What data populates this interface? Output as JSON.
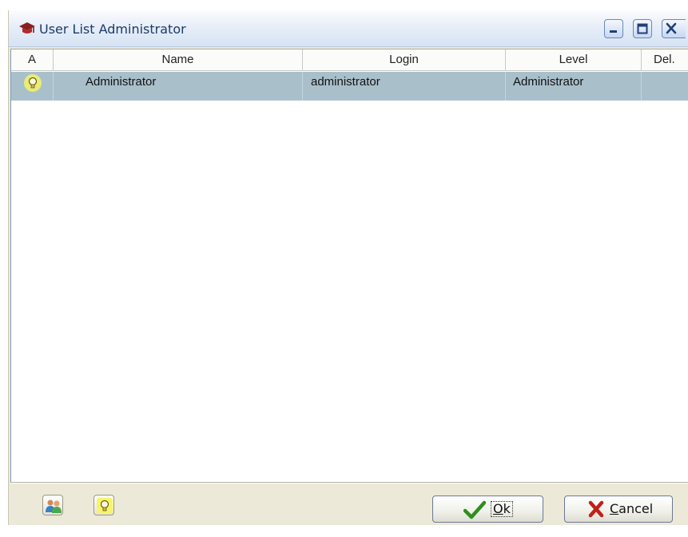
{
  "window": {
    "title": "User List Administrator",
    "app_icon": "mortarboard-icon",
    "controls": [
      "minimize-icon",
      "maximize-icon",
      "close-icon"
    ]
  },
  "grid": {
    "columns": [
      "A",
      "Name",
      "Login",
      "Level",
      "Del."
    ],
    "rows": [
      {
        "active_icon": "lightbulb-icon",
        "name": "Administrator",
        "login": "administrator",
        "level": "Administrator",
        "del": ""
      }
    ],
    "selected_row_color": "#a9c0cb"
  },
  "toolbar": {
    "users_icon": "users-icon",
    "activate_icon": "lightbulb-icon"
  },
  "buttons": {
    "ok_label": "Ok",
    "cancel_label": "Cancel",
    "ok_icon": "checkmark-icon",
    "cancel_icon": "cross-icon"
  }
}
